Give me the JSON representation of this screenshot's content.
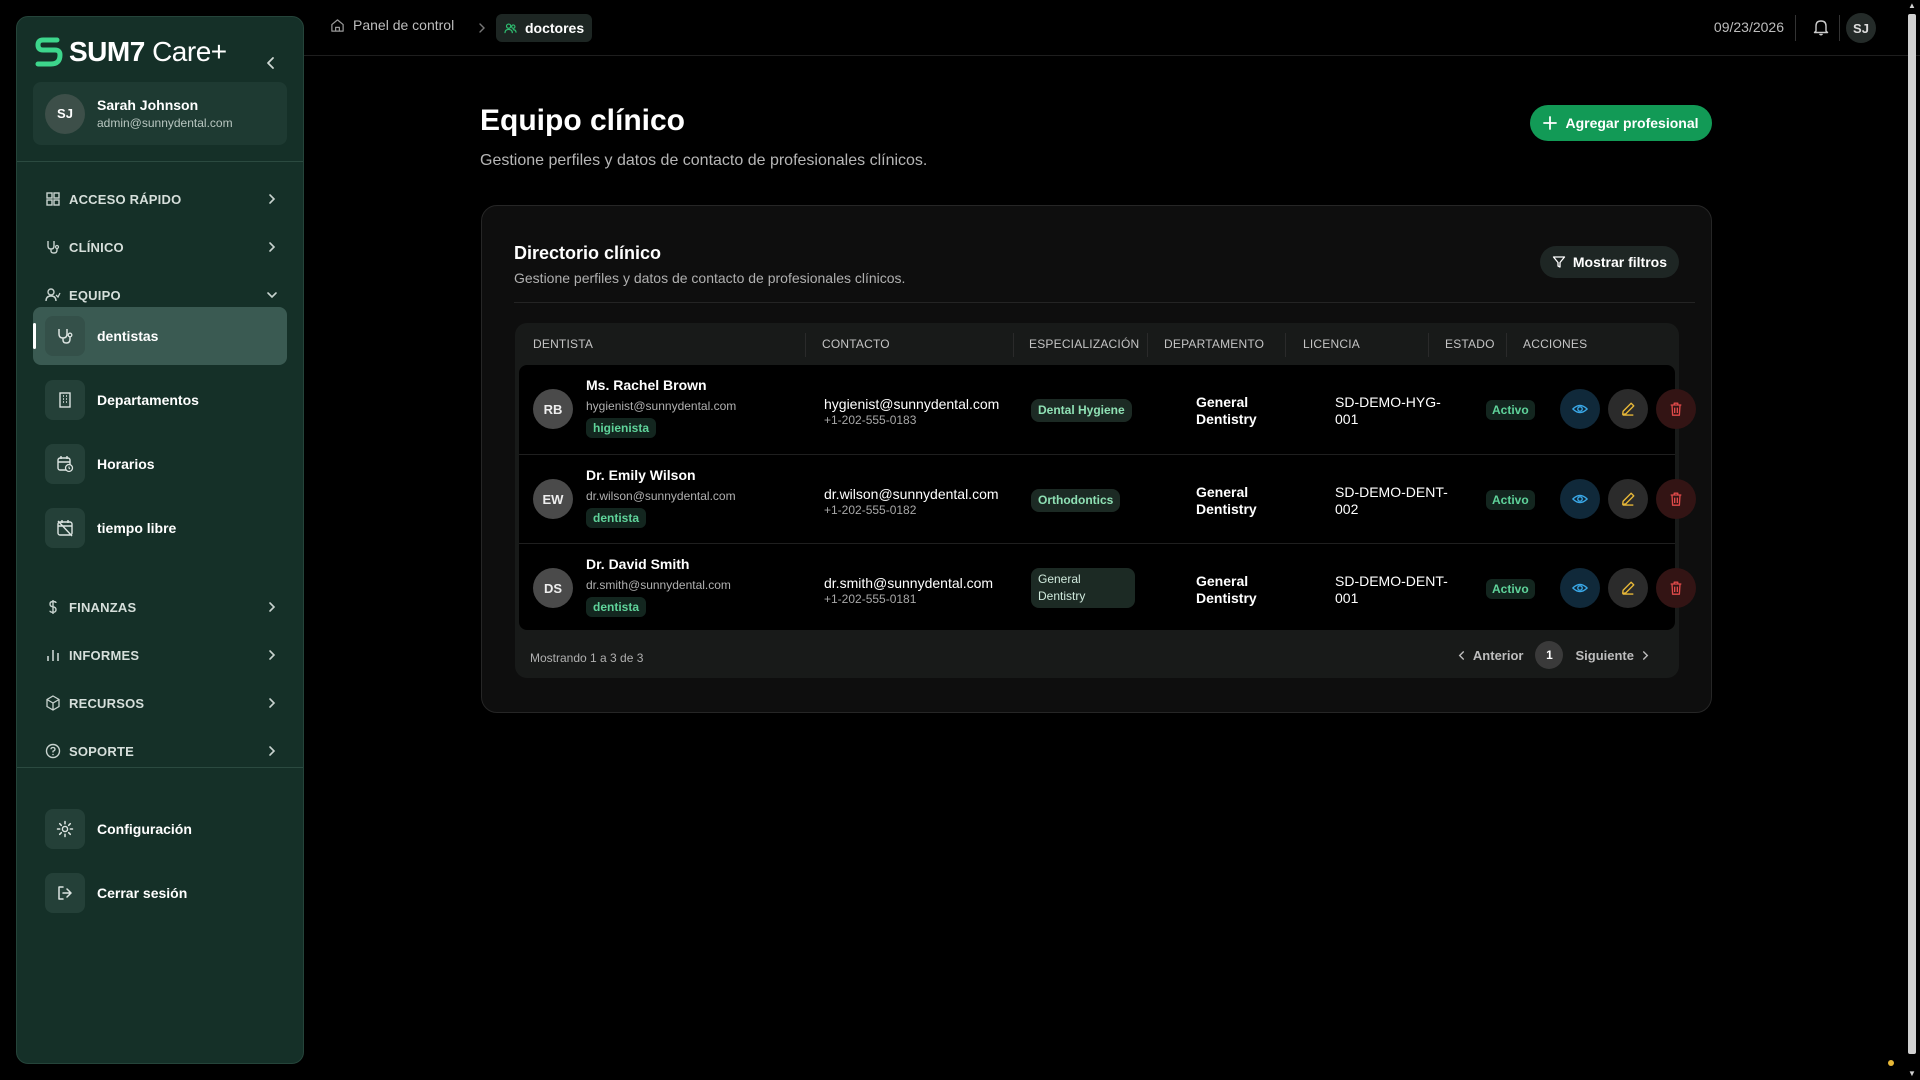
{
  "brand": {
    "name": "SUM7",
    "suffix": "Care+"
  },
  "user": {
    "initials": "SJ",
    "name": "Sarah Johnson",
    "email": "admin@sunnydental.com"
  },
  "nav": {
    "quick": "ACCESO RÁPIDO",
    "clinical": "CLÍNICO",
    "team": "EQUIPO",
    "team_items": [
      "dentistas",
      "Departamentos",
      "Horarios",
      "tiempo libre"
    ],
    "finance": "FINANZAS",
    "reports": "INFORMES",
    "resources": "RECURSOS",
    "support": "SOPORTE",
    "settings": "Configuración",
    "logout": "Cerrar sesión"
  },
  "breadcrumb": {
    "home": "Panel de control",
    "current": "doctores"
  },
  "topbar": {
    "date": "09/23/2026",
    "avatar": "SJ"
  },
  "page": {
    "title": "Equipo clínico",
    "subtitle": "Gestione perfiles y datos de contacto de profesionales clínicos.",
    "add_button": "Agregar profesional"
  },
  "card": {
    "title": "Directorio clínico",
    "subtitle": "Gestione perfiles y datos de contacto de profesionales clínicos.",
    "filter_button": "Mostrar filtros"
  },
  "table": {
    "headers": [
      "DENTISTA",
      "CONTACTO",
      "ESPECIALIZACIÓN",
      "DEPARTAMENTO",
      "LICENCIA",
      "ESTADO",
      "ACCIONES"
    ],
    "rows": [
      {
        "initials": "RB",
        "name": "Ms. Rachel Brown",
        "email": "hygienist@sunnydental.com",
        "role": "higienista",
        "contact": "hygienist@sunnydental.com",
        "phone": "+1-202-555-0183",
        "specialization": "Dental Hygiene",
        "department": "General Dentistry",
        "license": "SD-DEMO-HYG-001",
        "status": "Activo"
      },
      {
        "initials": "EW",
        "name": "Dr. Emily Wilson",
        "email": "dr.wilson@sunnydental.com",
        "role": "dentista",
        "contact": "dr.wilson@sunnydental.com",
        "phone": "+1-202-555-0182",
        "specialization": "Orthodontics",
        "department": "General Dentistry",
        "license": "SD-DEMO-DENT-002",
        "status": "Activo"
      },
      {
        "initials": "DS",
        "name": "Dr. David Smith",
        "email": "dr.smith@sunnydental.com",
        "role": "dentista",
        "contact": "dr.smith@sunnydental.com",
        "phone": "+1-202-555-0181",
        "specialization": "General Dentistry",
        "department": "General Dentistry",
        "license": "SD-DEMO-DENT-001",
        "status": "Activo"
      }
    ],
    "footer_info": "Mostrando 1 a 3 de 3",
    "prev": "Anterior",
    "page": "1",
    "next": "Siguiente"
  },
  "colors": {
    "accent": "#129a56",
    "sidebar": "#153028",
    "status": "#5fd39a",
    "view": "#3aa8e8",
    "edit": "#e8b838",
    "delete": "#e04a4a"
  }
}
